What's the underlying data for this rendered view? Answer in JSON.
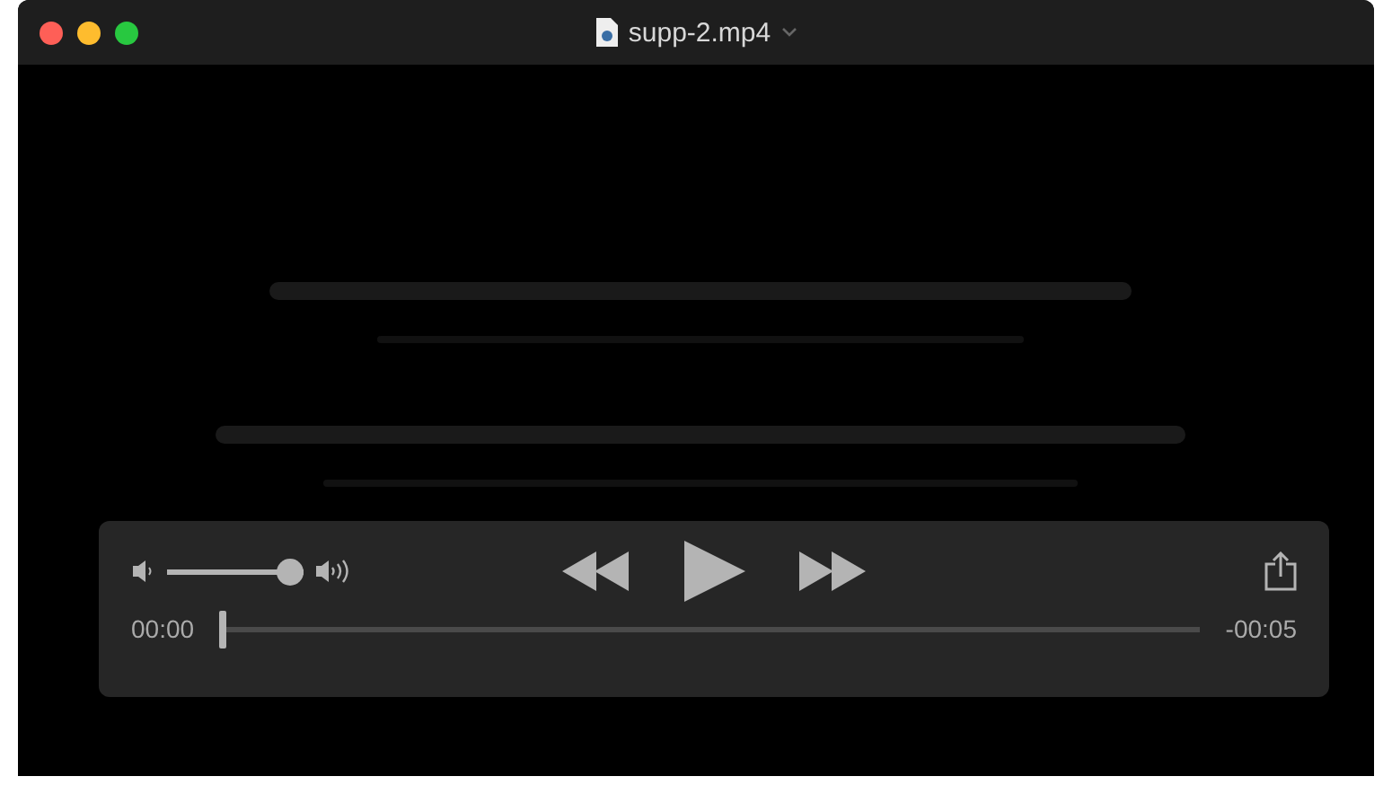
{
  "window": {
    "title": "supp-2.mp4"
  },
  "controls": {
    "volume": {
      "level": 1
    },
    "playing": false,
    "elapsed": "00:00",
    "remaining": "-00:05",
    "progress": {
      "level": 0
    }
  }
}
